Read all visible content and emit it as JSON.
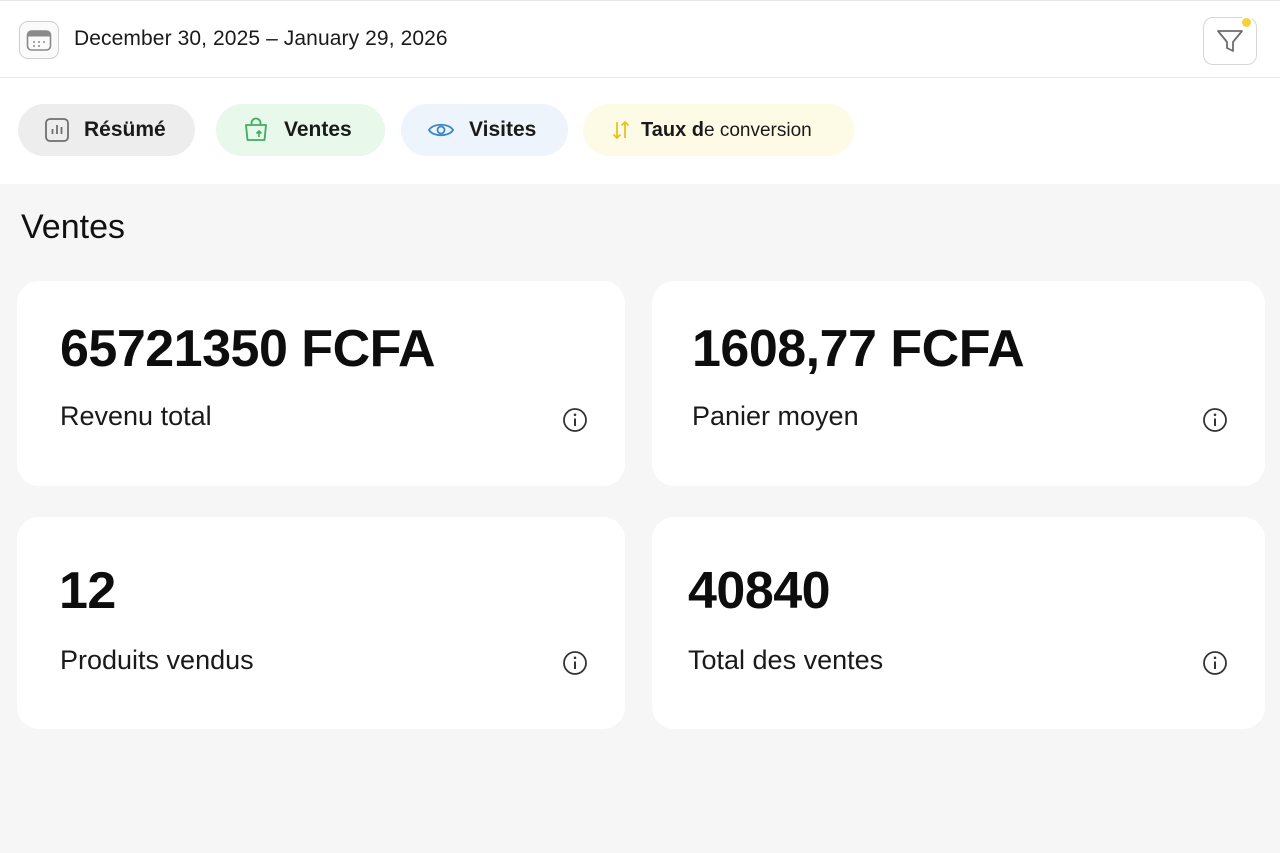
{
  "header": {
    "date_range": "December 30, 2025 – January 29, 2026",
    "calendar_icon": "calendar-icon",
    "filter_icon": "filter-icon",
    "filter_badge_color": "#f3d23c"
  },
  "tabs": [
    {
      "label": "Résümé",
      "icon": "bar-chart-icon",
      "bg": "#ededed"
    },
    {
      "label": "Ventes",
      "icon": "shopping-bag-icon",
      "bg": "#e8f8ea"
    },
    {
      "label": "Visites",
      "icon": "eye-icon",
      "bg": "#eef4fb"
    },
    {
      "label_bold": "Taux d",
      "label_rest": "e conversion",
      "icon": "sort-arrows-icon",
      "bg": "#fdfbe6"
    }
  ],
  "section": {
    "title": "Ventes"
  },
  "cards": [
    {
      "value": "65721350 FCFA",
      "label": "Revenu total"
    },
    {
      "value": "1608,77 FCFA",
      "label": "Panier moyen"
    },
    {
      "value": "12",
      "label": "Produits vendus"
    },
    {
      "value": "40840",
      "label": "Total des ventes"
    }
  ],
  "colors": {
    "accent_green": "#3fae5a",
    "accent_blue": "#3a86c8",
    "accent_yellow": "#e8c21e"
  }
}
